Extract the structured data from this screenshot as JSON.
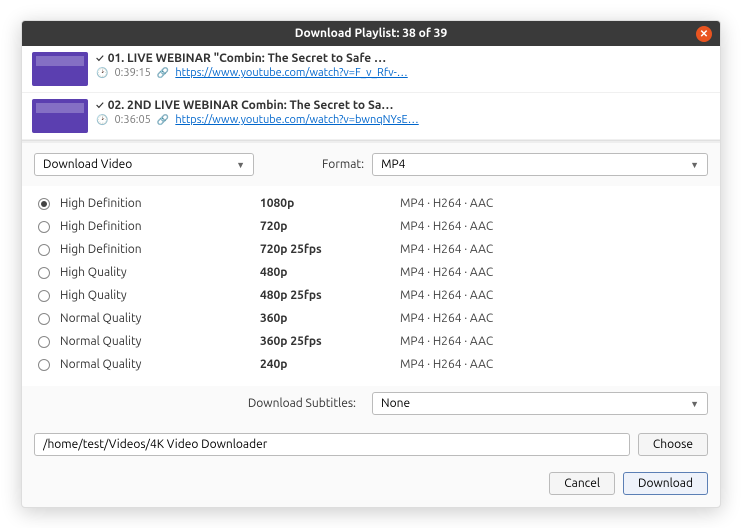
{
  "titlebar": {
    "title": "Download Playlist: 38 of 39"
  },
  "playlist": [
    {
      "title": "01. LIVE WEBINAR \"Combin: The Secret to Safe …",
      "duration": "0:39:15",
      "url": "https://www.youtube.com/watch?v=F_v_Rfv-…"
    },
    {
      "title": "02. 2ND LIVE WEBINAR Combin: The Secret to Sa…",
      "duration": "0:36:05",
      "url": "https://www.youtube.com/watch?v=bwnqNYsE…"
    }
  ],
  "action": {
    "label": "Download Video"
  },
  "format": {
    "label": "Format:",
    "value": "MP4"
  },
  "qualities": [
    {
      "name": "High Definition",
      "res": "1080p",
      "codec": "MP4 · H264 · AAC",
      "selected": true
    },
    {
      "name": "High Definition",
      "res": "720p",
      "codec": "MP4 · H264 · AAC",
      "selected": false
    },
    {
      "name": "High Definition",
      "res": "720p 25fps",
      "codec": "MP4 · H264 · AAC",
      "selected": false
    },
    {
      "name": "High Quality",
      "res": "480p",
      "codec": "MP4 · H264 · AAC",
      "selected": false
    },
    {
      "name": "High Quality",
      "res": "480p 25fps",
      "codec": "MP4 · H264 · AAC",
      "selected": false
    },
    {
      "name": "Normal Quality",
      "res": "360p",
      "codec": "MP4 · H264 · AAC",
      "selected": false
    },
    {
      "name": "Normal Quality",
      "res": "360p 25fps",
      "codec": "MP4 · H264 · AAC",
      "selected": false
    },
    {
      "name": "Normal Quality",
      "res": "240p",
      "codec": "MP4 · H264 · AAC",
      "selected": false
    }
  ],
  "subtitles": {
    "label": "Download Subtitles:",
    "value": "None"
  },
  "path": {
    "value": "/home/test/Videos/4K Video Downloader",
    "choose": "Choose"
  },
  "footer": {
    "cancel": "Cancel",
    "download": "Download"
  }
}
